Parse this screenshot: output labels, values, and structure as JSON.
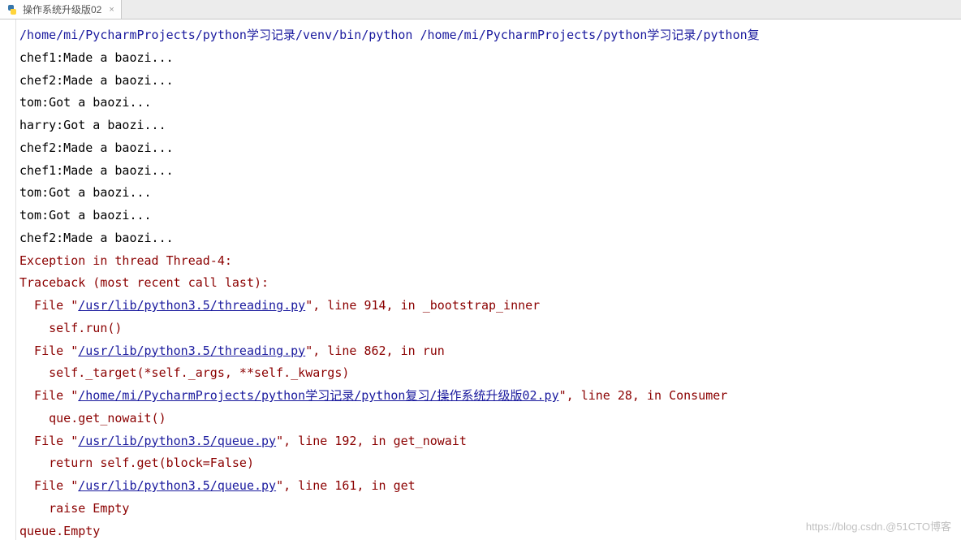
{
  "tab": {
    "title": "操作系统升级版02",
    "close_glyph": "×"
  },
  "console": {
    "command": "/home/mi/PycharmProjects/python学习记录/venv/bin/python /home/mi/PycharmProjects/python学习记录/python复",
    "output": [
      "chef1:Made a baozi...",
      "chef2:Made a baozi...",
      "tom:Got a baozi...",
      "harry:Got a baozi...",
      "chef2:Made a baozi...",
      "chef1:Made a baozi...",
      "tom:Got a baozi...",
      "tom:Got a baozi...",
      "chef2:Made a baozi..."
    ],
    "traceback": {
      "header": "Exception in thread Thread-4:",
      "subheader": "Traceback (most recent call last):",
      "frames": [
        {
          "prefix": "  File \"",
          "file": "/usr/lib/python3.5/threading.py",
          "suffix": "\", line 914, in _bootstrap_inner",
          "code": "    self.run()"
        },
        {
          "prefix": "  File \"",
          "file": "/usr/lib/python3.5/threading.py",
          "suffix": "\", line 862, in run",
          "code": "    self._target(*self._args, **self._kwargs)"
        },
        {
          "prefix": "  File \"",
          "file": "/home/mi/PycharmProjects/python学习记录/python复习/操作系统升级版02.py",
          "suffix": "\", line 28, in Consumer",
          "code": "    que.get_nowait()"
        },
        {
          "prefix": "  File \"",
          "file": "/usr/lib/python3.5/queue.py",
          "suffix": "\", line 192, in get_nowait",
          "code": "    return self.get(block=False)"
        },
        {
          "prefix": "  File \"",
          "file": "/usr/lib/python3.5/queue.py",
          "suffix": "\", line 161, in get",
          "code": "    raise Empty"
        }
      ],
      "exception": "queue.Empty"
    }
  },
  "watermark": "https://blog.csdn.@51CTO博客"
}
